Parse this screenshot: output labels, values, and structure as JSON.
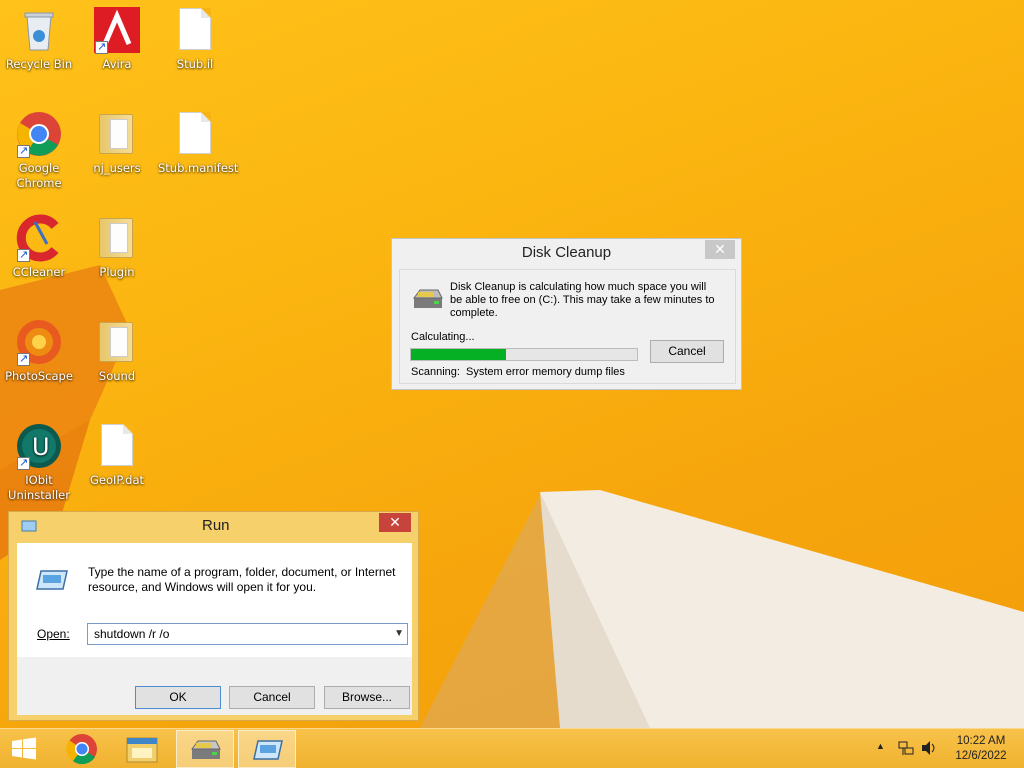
{
  "desktop": {
    "icons": [
      {
        "label": "Recycle Bin",
        "icon": "recycle-bin-icon"
      },
      {
        "label": "Avira",
        "icon": "avira-icon"
      },
      {
        "label": "Stub.il",
        "icon": "file-icon"
      },
      {
        "label": "Google Chrome",
        "icon": "chrome-icon"
      },
      {
        "label": "nj_users",
        "icon": "folder-icon"
      },
      {
        "label": "Stub.manifest",
        "icon": "file-icon"
      },
      {
        "label": "CCleaner",
        "icon": "ccleaner-icon"
      },
      {
        "label": "Plugin",
        "icon": "folder-icon"
      },
      {
        "label": "PhotoScape",
        "icon": "photoscape-icon"
      },
      {
        "label": "Sound",
        "icon": "folder-icon"
      },
      {
        "label": "IObit Uninstaller",
        "icon": "iobit-uninstaller-icon"
      },
      {
        "label": "GeoIP.dat",
        "icon": "file-icon"
      }
    ]
  },
  "disk_cleanup": {
    "title": "Disk Cleanup",
    "message": "Disk Cleanup is calculating how much space you will be able to free on  (C:). This may take a few minutes to complete.",
    "status": "Calculating...",
    "progress": 0.42,
    "cancel_label": "Cancel",
    "scanning_label": "Scanning:",
    "scanning_item": "System error memory dump files",
    "close_symbol": "✕"
  },
  "run": {
    "title": "Run",
    "description": "Type the name of a program, folder, document, or Internet resource, and Windows will open it for you.",
    "open_label": "Open:",
    "open_value": "shutdown /r /o",
    "ok_label": "OK",
    "cancel_label": "Cancel",
    "browse_label": "Browse...",
    "close_symbol": "✕"
  },
  "taskbar": {
    "time": "10:22 AM",
    "date": "12/6/2022",
    "items": [
      "start-button",
      "chrome",
      "file-explorer",
      "disk-cleanup",
      "run"
    ]
  },
  "colors": {
    "desktop": "#f6a50c",
    "progress": "#06b025",
    "run_frame": "#f6d16b",
    "close_red": "#c7443d"
  }
}
